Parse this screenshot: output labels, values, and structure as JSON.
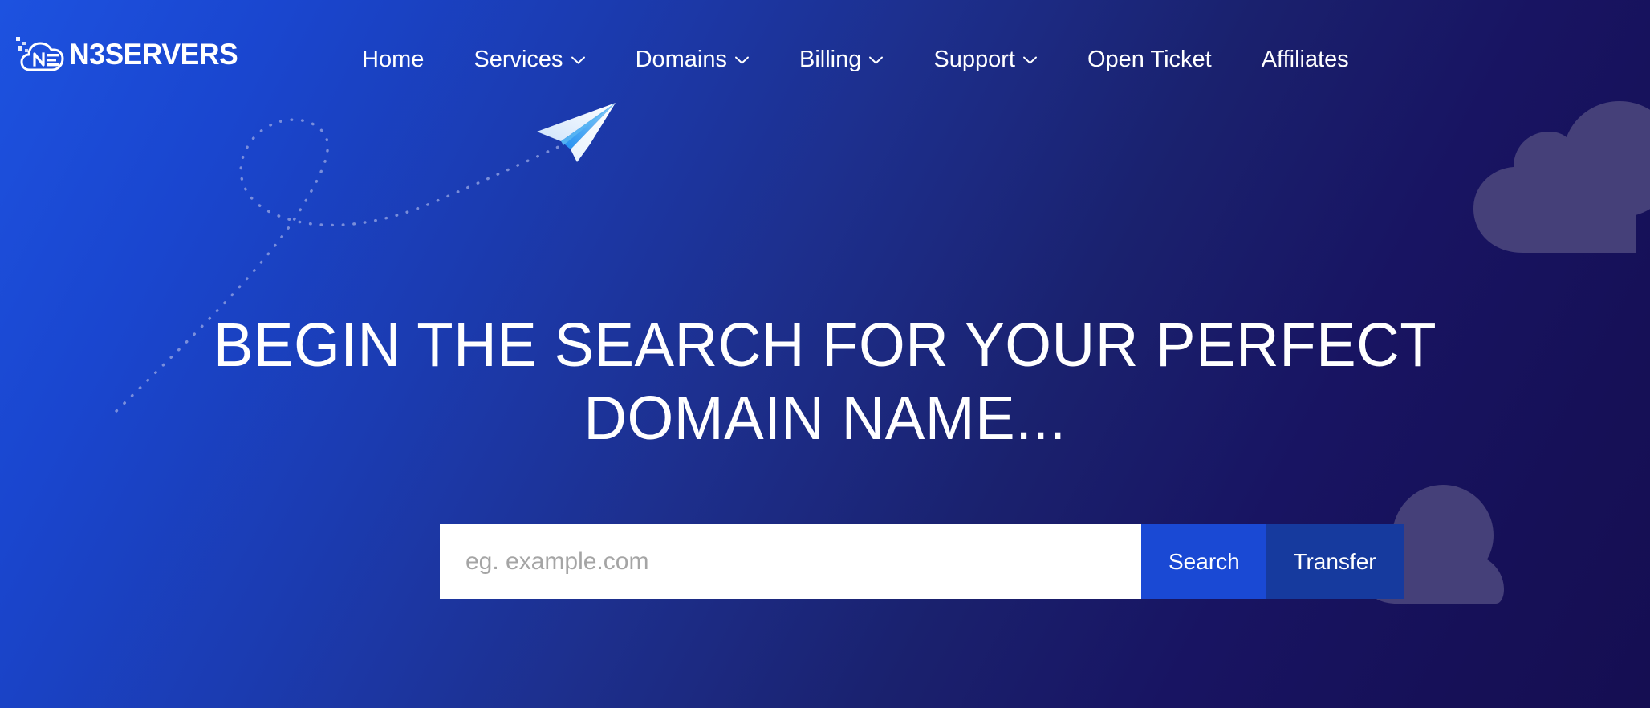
{
  "brand": {
    "name": "N3SERVERS",
    "logo_icon": "cloud-n3-logo-icon"
  },
  "nav": {
    "items": [
      {
        "label": "Home",
        "has_dropdown": false,
        "icon": ""
      },
      {
        "label": "Services",
        "has_dropdown": true,
        "icon": "chevron-down-icon"
      },
      {
        "label": "Domains",
        "has_dropdown": true,
        "icon": "chevron-down-icon"
      },
      {
        "label": "Billing",
        "has_dropdown": true,
        "icon": "chevron-down-icon"
      },
      {
        "label": "Support",
        "has_dropdown": true,
        "icon": "chevron-down-icon"
      },
      {
        "label": "Open Ticket",
        "has_dropdown": false,
        "icon": ""
      },
      {
        "label": "Affiliates",
        "has_dropdown": false,
        "icon": ""
      }
    ]
  },
  "hero": {
    "title": "BEGIN THE SEARCH FOR YOUR PERFECT DOMAIN NAME..."
  },
  "search": {
    "placeholder": "eg. example.com",
    "value": "",
    "search_label": "Search",
    "transfer_label": "Transfer"
  },
  "decor": {
    "plane_icon": "paper-plane-icon",
    "path_icon": "dotted-flight-path-icon",
    "cloud_icon": "cloud-shape-icon"
  },
  "colors": {
    "gradient_start": "#1d52e0",
    "gradient_end": "#150e52",
    "search_button": "#1a49d4",
    "transfer_button": "#163a9e",
    "cloud": "#4a447c",
    "input_background": "#ffffff",
    "placeholder_text": "#a5a5a5",
    "text": "#ffffff"
  }
}
